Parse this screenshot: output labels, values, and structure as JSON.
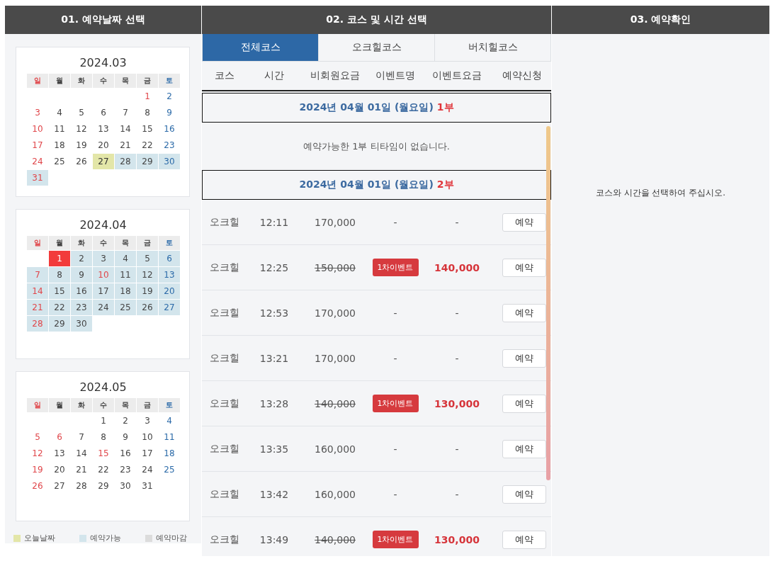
{
  "headers": [
    "01. 예약날짜 선택",
    "02. 코스 및 시간 선택",
    "03. 예약확인"
  ],
  "calendars": [
    {
      "title": "2024.03",
      "weekdays": [
        {
          "label": "일",
          "color": "#e0464a"
        },
        {
          "label": "월",
          "color": "#444444"
        },
        {
          "label": "화",
          "color": "#444444"
        },
        {
          "label": "수",
          "color": "#444444"
        },
        {
          "label": "목",
          "color": "#444444"
        },
        {
          "label": "금",
          "color": "#444444"
        },
        {
          "label": "토",
          "color": "#2b6aa8"
        }
      ],
      "weeks": [
        [
          {
            "kind": "blank"
          },
          {
            "kind": "blank"
          },
          {
            "kind": "blank"
          },
          {
            "kind": "blank"
          },
          {
            "kind": "blank"
          },
          {
            "d": "1",
            "color": "#e0464a",
            "kind": "plain",
            "selected": false
          },
          {
            "d": "2",
            "color": "#2b6aa8",
            "kind": "plain",
            "selected": false
          }
        ],
        [
          {
            "d": "3",
            "color": "#e0464a",
            "kind": "plain",
            "selected": false
          },
          {
            "d": "4",
            "color": "#444444",
            "kind": "plain",
            "selected": false
          },
          {
            "d": "5",
            "color": "#444444",
            "kind": "plain",
            "selected": false
          },
          {
            "d": "6",
            "color": "#444444",
            "kind": "plain",
            "selected": false
          },
          {
            "d": "7",
            "color": "#444444",
            "kind": "plain",
            "selected": false
          },
          {
            "d": "8",
            "color": "#444444",
            "kind": "plain",
            "selected": false
          },
          {
            "d": "9",
            "color": "#2b6aa8",
            "kind": "plain",
            "selected": false
          }
        ],
        [
          {
            "d": "10",
            "color": "#e0464a",
            "kind": "plain",
            "selected": false
          },
          {
            "d": "11",
            "color": "#444444",
            "kind": "plain",
            "selected": false
          },
          {
            "d": "12",
            "color": "#444444",
            "kind": "plain",
            "selected": false
          },
          {
            "d": "13",
            "color": "#444444",
            "kind": "plain",
            "selected": false
          },
          {
            "d": "14",
            "color": "#444444",
            "kind": "plain",
            "selected": false
          },
          {
            "d": "15",
            "color": "#444444",
            "kind": "plain",
            "selected": false
          },
          {
            "d": "16",
            "color": "#2b6aa8",
            "kind": "plain",
            "selected": false
          }
        ],
        [
          {
            "d": "17",
            "color": "#e0464a",
            "kind": "plain",
            "selected": false
          },
          {
            "d": "18",
            "color": "#444444",
            "kind": "plain",
            "selected": false
          },
          {
            "d": "19",
            "color": "#444444",
            "kind": "plain",
            "selected": false
          },
          {
            "d": "20",
            "color": "#444444",
            "kind": "plain",
            "selected": false
          },
          {
            "d": "21",
            "color": "#444444",
            "kind": "plain",
            "selected": false
          },
          {
            "d": "22",
            "color": "#444444",
            "kind": "plain",
            "selected": false
          },
          {
            "d": "23",
            "color": "#2b6aa8",
            "kind": "plain",
            "selected": false
          }
        ],
        [
          {
            "d": "24",
            "color": "#e0464a",
            "kind": "plain",
            "selected": false
          },
          {
            "d": "25",
            "color": "#444444",
            "kind": "plain",
            "selected": false
          },
          {
            "d": "26",
            "color": "#444444",
            "kind": "plain",
            "selected": false
          },
          {
            "d": "27",
            "color": "#333333",
            "kind": "today",
            "selected": false
          },
          {
            "d": "28",
            "color": "#444444",
            "kind": "available",
            "selected": false
          },
          {
            "d": "29",
            "color": "#444444",
            "kind": "available",
            "selected": false
          },
          {
            "d": "30",
            "color": "#2b6aa8",
            "kind": "available",
            "selected": false
          }
        ],
        [
          {
            "d": "31",
            "color": "#e0464a",
            "kind": "available",
            "selected": false
          }
        ]
      ]
    },
    {
      "title": "2024.04",
      "weekdays": [
        {
          "label": "일",
          "color": "#e0464a"
        },
        {
          "label": "월",
          "color": "#444444"
        },
        {
          "label": "화",
          "color": "#444444"
        },
        {
          "label": "수",
          "color": "#444444"
        },
        {
          "label": "목",
          "color": "#444444"
        },
        {
          "label": "금",
          "color": "#444444"
        },
        {
          "label": "토",
          "color": "#2b6aa8"
        }
      ],
      "weeks": [
        [
          {
            "kind": "blank"
          },
          {
            "d": "1",
            "color": "#ffffff",
            "kind": "available",
            "selected": true
          },
          {
            "d": "2",
            "color": "#444444",
            "kind": "available",
            "selected": false
          },
          {
            "d": "3",
            "color": "#444444",
            "kind": "available",
            "selected": false
          },
          {
            "d": "4",
            "color": "#444444",
            "kind": "available",
            "selected": false
          },
          {
            "d": "5",
            "color": "#444444",
            "kind": "available",
            "selected": false
          },
          {
            "d": "6",
            "color": "#2b6aa8",
            "kind": "available",
            "selected": false
          }
        ],
        [
          {
            "d": "7",
            "color": "#e0464a",
            "kind": "available",
            "selected": false
          },
          {
            "d": "8",
            "color": "#444444",
            "kind": "available",
            "selected": false
          },
          {
            "d": "9",
            "color": "#444444",
            "kind": "available",
            "selected": false
          },
          {
            "d": "10",
            "color": "#e0464a",
            "kind": "available",
            "selected": false
          },
          {
            "d": "11",
            "color": "#444444",
            "kind": "available",
            "selected": false
          },
          {
            "d": "12",
            "color": "#444444",
            "kind": "available",
            "selected": false
          },
          {
            "d": "13",
            "color": "#2b6aa8",
            "kind": "available",
            "selected": false
          }
        ],
        [
          {
            "d": "14",
            "color": "#e0464a",
            "kind": "available",
            "selected": false
          },
          {
            "d": "15",
            "color": "#444444",
            "kind": "available",
            "selected": false
          },
          {
            "d": "16",
            "color": "#444444",
            "kind": "available",
            "selected": false
          },
          {
            "d": "17",
            "color": "#444444",
            "kind": "available",
            "selected": false
          },
          {
            "d": "18",
            "color": "#444444",
            "kind": "available",
            "selected": false
          },
          {
            "d": "19",
            "color": "#444444",
            "kind": "available",
            "selected": false
          },
          {
            "d": "20",
            "color": "#2b6aa8",
            "kind": "available",
            "selected": false
          }
        ],
        [
          {
            "d": "21",
            "color": "#e0464a",
            "kind": "available",
            "selected": false
          },
          {
            "d": "22",
            "color": "#444444",
            "kind": "available",
            "selected": false
          },
          {
            "d": "23",
            "color": "#444444",
            "kind": "available",
            "selected": false
          },
          {
            "d": "24",
            "color": "#444444",
            "kind": "available",
            "selected": false
          },
          {
            "d": "25",
            "color": "#444444",
            "kind": "available",
            "selected": false
          },
          {
            "d": "26",
            "color": "#444444",
            "kind": "available",
            "selected": false
          },
          {
            "d": "27",
            "color": "#2b6aa8",
            "kind": "available",
            "selected": false
          }
        ],
        [
          {
            "d": "28",
            "color": "#e0464a",
            "kind": "available",
            "selected": false
          },
          {
            "d": "29",
            "color": "#444444",
            "kind": "available",
            "selected": false
          },
          {
            "d": "30",
            "color": "#444444",
            "kind": "available",
            "selected": false
          }
        ]
      ]
    },
    {
      "title": "2024.05",
      "weekdays": [
        {
          "label": "일",
          "color": "#e0464a"
        },
        {
          "label": "월",
          "color": "#444444"
        },
        {
          "label": "화",
          "color": "#444444"
        },
        {
          "label": "수",
          "color": "#444444"
        },
        {
          "label": "목",
          "color": "#444444"
        },
        {
          "label": "금",
          "color": "#444444"
        },
        {
          "label": "토",
          "color": "#2b6aa8"
        }
      ],
      "weeks": [
        [
          {
            "kind": "blank"
          },
          {
            "kind": "blank"
          },
          {
            "kind": "blank"
          },
          {
            "d": "1",
            "color": "#444444",
            "kind": "plain",
            "selected": false
          },
          {
            "d": "2",
            "color": "#444444",
            "kind": "plain",
            "selected": false
          },
          {
            "d": "3",
            "color": "#444444",
            "kind": "plain",
            "selected": false
          },
          {
            "d": "4",
            "color": "#2b6aa8",
            "kind": "plain",
            "selected": false
          }
        ],
        [
          {
            "d": "5",
            "color": "#e0464a",
            "kind": "plain",
            "selected": false
          },
          {
            "d": "6",
            "color": "#e0464a",
            "kind": "plain",
            "selected": false
          },
          {
            "d": "7",
            "color": "#444444",
            "kind": "plain",
            "selected": false
          },
          {
            "d": "8",
            "color": "#444444",
            "kind": "plain",
            "selected": false
          },
          {
            "d": "9",
            "color": "#444444",
            "kind": "plain",
            "selected": false
          },
          {
            "d": "10",
            "color": "#444444",
            "kind": "plain",
            "selected": false
          },
          {
            "d": "11",
            "color": "#2b6aa8",
            "kind": "plain",
            "selected": false
          }
        ],
        [
          {
            "d": "12",
            "color": "#e0464a",
            "kind": "plain",
            "selected": false
          },
          {
            "d": "13",
            "color": "#444444",
            "kind": "plain",
            "selected": false
          },
          {
            "d": "14",
            "color": "#444444",
            "kind": "plain",
            "selected": false
          },
          {
            "d": "15",
            "color": "#e0464a",
            "kind": "plain",
            "selected": false
          },
          {
            "d": "16",
            "color": "#444444",
            "kind": "plain",
            "selected": false
          },
          {
            "d": "17",
            "color": "#444444",
            "kind": "plain",
            "selected": false
          },
          {
            "d": "18",
            "color": "#2b6aa8",
            "kind": "plain",
            "selected": false
          }
        ],
        [
          {
            "d": "19",
            "color": "#e0464a",
            "kind": "plain",
            "selected": false
          },
          {
            "d": "20",
            "color": "#444444",
            "kind": "plain",
            "selected": false
          },
          {
            "d": "21",
            "color": "#444444",
            "kind": "plain",
            "selected": false
          },
          {
            "d": "22",
            "color": "#444444",
            "kind": "plain",
            "selected": false
          },
          {
            "d": "23",
            "color": "#444444",
            "kind": "plain",
            "selected": false
          },
          {
            "d": "24",
            "color": "#444444",
            "kind": "plain",
            "selected": false
          },
          {
            "d": "25",
            "color": "#2b6aa8",
            "kind": "plain",
            "selected": false
          }
        ],
        [
          {
            "d": "26",
            "color": "#e0464a",
            "kind": "plain",
            "selected": false
          },
          {
            "d": "27",
            "color": "#444444",
            "kind": "plain",
            "selected": false
          },
          {
            "d": "28",
            "color": "#444444",
            "kind": "plain",
            "selected": false
          },
          {
            "d": "29",
            "color": "#444444",
            "kind": "plain",
            "selected": false
          },
          {
            "d": "30",
            "color": "#444444",
            "kind": "plain",
            "selected": false
          },
          {
            "d": "31",
            "color": "#444444",
            "kind": "plain",
            "selected": false
          }
        ]
      ]
    }
  ],
  "legend": [
    {
      "label": "오늘날짜",
      "color": "#e3e6a8"
    },
    {
      "label": "예약가능",
      "color": "#d3e5ec"
    },
    {
      "label": "예약마감",
      "color": "#dcdcdc"
    }
  ],
  "tabs": [
    {
      "label": "전체코스",
      "selected": true
    },
    {
      "label": "오크힐코스",
      "selected": false
    },
    {
      "label": "버치힐코스",
      "selected": false
    }
  ],
  "columns": [
    "코스",
    "시간",
    "비회원요금",
    "이벤트명",
    "이벤트요금",
    "예약신청"
  ],
  "sections": [
    {
      "date": "2024년 04월 01일 (월요일)",
      "part": "1부",
      "empty_message": "예약가능한 1부 티타임이 없습니다."
    },
    {
      "date": "2024년 04월 01일 (월요일)",
      "part": "2부",
      "rows": [
        {
          "course": "오크힐",
          "time": "12:11",
          "price": "170,000",
          "has_event": false,
          "event": "-",
          "event_price": "-",
          "button": "예약"
        },
        {
          "course": "오크힐",
          "time": "12:25",
          "price": "150,000",
          "has_event": true,
          "event": "1차이벤트",
          "event_price": "140,000",
          "button": "예약"
        },
        {
          "course": "오크힐",
          "time": "12:53",
          "price": "170,000",
          "has_event": false,
          "event": "-",
          "event_price": "-",
          "button": "예약"
        },
        {
          "course": "오크힐",
          "time": "13:21",
          "price": "170,000",
          "has_event": false,
          "event": "-",
          "event_price": "-",
          "button": "예약"
        },
        {
          "course": "오크힐",
          "time": "13:28",
          "price": "140,000",
          "has_event": true,
          "event": "1차이벤트",
          "event_price": "130,000",
          "button": "예약"
        },
        {
          "course": "오크힐",
          "time": "13:35",
          "price": "160,000",
          "has_event": false,
          "event": "-",
          "event_price": "-",
          "button": "예약"
        },
        {
          "course": "오크힐",
          "time": "13:42",
          "price": "160,000",
          "has_event": false,
          "event": "-",
          "event_price": "-",
          "button": "예약"
        },
        {
          "course": "오크힐",
          "time": "13:49",
          "price": "140,000",
          "has_event": true,
          "event": "1차이벤트",
          "event_price": "130,000",
          "button": "예약"
        }
      ]
    }
  ],
  "confirm_message": "코스와 시간을 선택하여 주십시오."
}
